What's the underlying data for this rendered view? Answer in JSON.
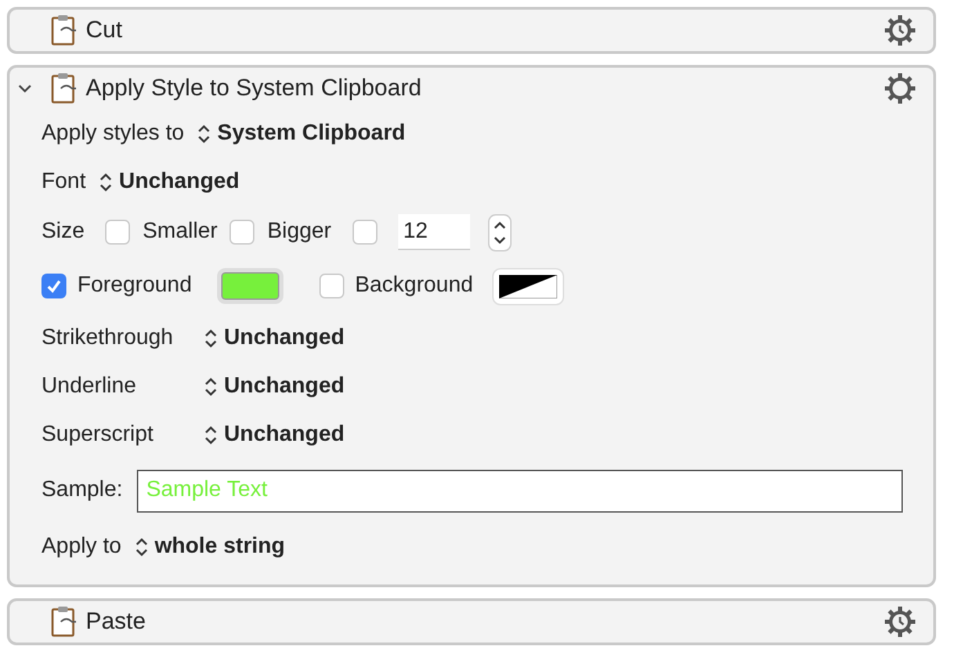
{
  "actions": [
    {
      "title": "Cut",
      "expanded": false
    },
    {
      "title": "Apply Style to System Clipboard",
      "expanded": true,
      "rows": [
        {
          "kind": "popup",
          "label": "Apply styles to",
          "value": "System Clipboard"
        },
        {
          "kind": "popup",
          "label": "Font",
          "value": "Unchanged"
        },
        {
          "kind": "size",
          "label": "Size",
          "smaller": {
            "label": "Smaller",
            "checked": false
          },
          "bigger": {
            "label": "Bigger",
            "checked": false
          },
          "exact": {
            "checked": false,
            "value": "12"
          }
        },
        {
          "kind": "colors",
          "foreground": {
            "label": "Foreground",
            "checked": true,
            "color": "#77f03c"
          },
          "background": {
            "label": "Background",
            "checked": false
          }
        },
        {
          "kind": "popup",
          "label": "Strikethrough",
          "value": "Unchanged"
        },
        {
          "kind": "popup",
          "label": "Underline",
          "value": "Unchanged"
        },
        {
          "kind": "popup",
          "label": "Superscript",
          "value": "Unchanged"
        },
        {
          "kind": "sample",
          "label": "Sample:",
          "value": "Sample Text"
        },
        {
          "kind": "popup",
          "label": "Apply to",
          "value": "whole string"
        }
      ]
    },
    {
      "title": "Paste",
      "expanded": false
    }
  ]
}
